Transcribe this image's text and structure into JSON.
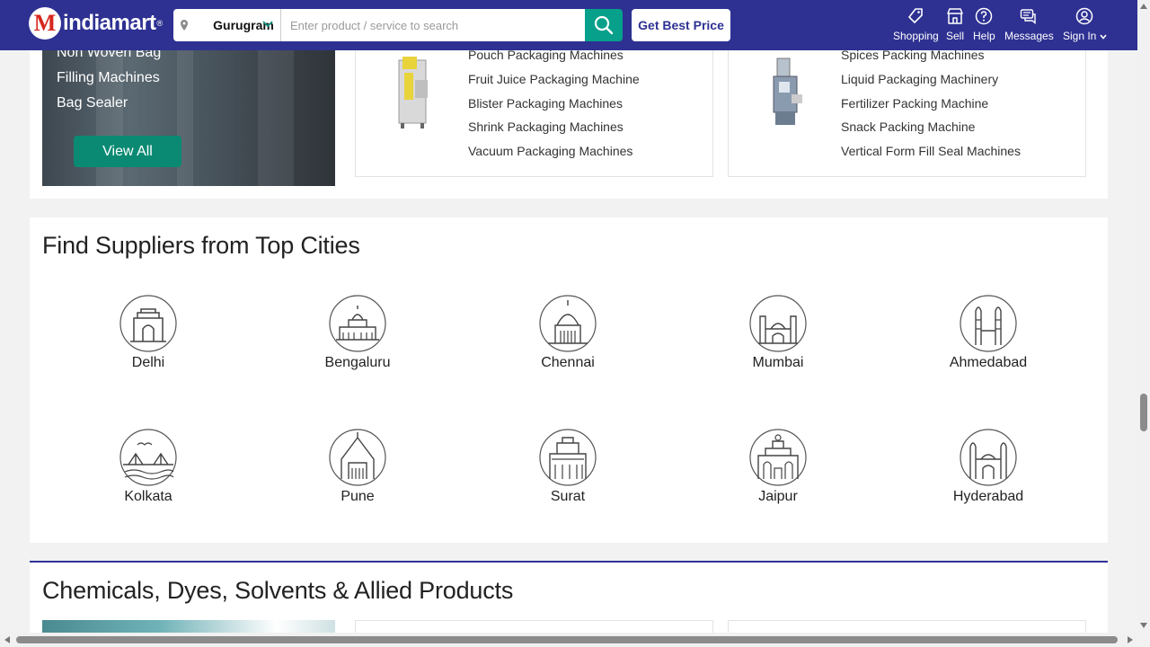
{
  "header": {
    "logo_letter": "M",
    "logo_text": "indiamart",
    "logo_reg": "®",
    "city": "Gurugram",
    "search_placeholder": "Enter product / service to search",
    "best_price_label": "Get Best Price",
    "nav": [
      {
        "label": "Shopping",
        "icon": "shopping-tag-icon"
      },
      {
        "label": "Sell",
        "icon": "store-icon"
      },
      {
        "label": "Help",
        "icon": "help-icon"
      },
      {
        "label": "Messages",
        "icon": "messages-icon"
      },
      {
        "label": "Sign In",
        "icon": "user-icon"
      }
    ]
  },
  "packaging": {
    "categories": [
      "Non Woven Bag",
      "Filling Machines",
      "Bag Sealer"
    ],
    "view_all": "View All",
    "card1_links": [
      "Pouch Packaging Machines",
      "Fruit Juice Packaging Machine",
      "Blister Packaging Machines",
      "Shrink Packaging Machines",
      "Vacuum Packaging Machines"
    ],
    "card2_links": [
      "Spices Packing Machines",
      "Liquid Packaging Machinery",
      "Fertilizer Packing Machine",
      "Snack Packing Machine",
      "Vertical Form Fill Seal Machines"
    ]
  },
  "cities": {
    "title": "Find Suppliers from Top Cities",
    "items": [
      "Delhi",
      "Bengaluru",
      "Chennai",
      "Mumbai",
      "Ahmedabad",
      "Kolkata",
      "Pune",
      "Surat",
      "Jaipur",
      "Hyderabad"
    ]
  },
  "chemicals": {
    "title": "Chemicals, Dyes, Solvents & Allied Products"
  },
  "colors": {
    "header_bg": "#2e3192",
    "search_btn": "#06a08b",
    "view_all_bg": "#0b8a73",
    "section_rule": "#2e3192"
  }
}
